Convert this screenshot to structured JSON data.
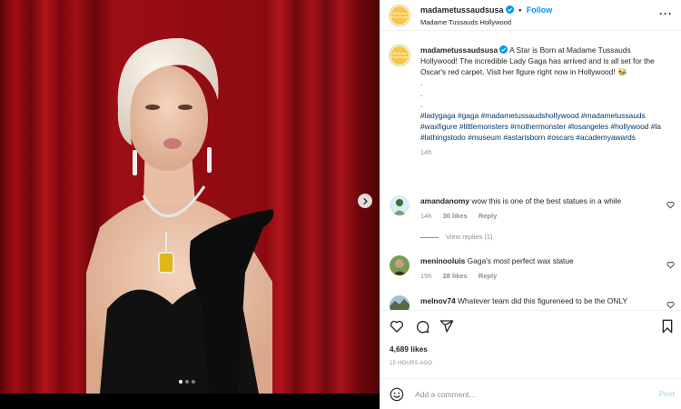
{
  "header": {
    "username": "madametussaudsusa",
    "separator": "•",
    "follow_label": "Follow",
    "location": "Madame Tussauds Hollywood",
    "more_label": "···",
    "avatar_text": "Madame Tussauds"
  },
  "caption": {
    "username": "madametussaudsusa",
    "text": "A Star is Born at Madame Tussauds Hollywood! The incredible Lady Gaga has arrived and is all set for the Oscar's red carpet. Visit her figure right now in Hollywood! 🐝",
    "dots": [
      ".",
      ".",
      "."
    ],
    "hashtags": "#ladygaga #gaga #madametussaudshollywood #madametussauds #waxfigure #littlemonsters #mothermonster #losangeles #hollywood #la #lathingstodo #museum #astarisborn #oscars #academyawards",
    "time": "14h"
  },
  "comments": [
    {
      "username": "amandanomy",
      "text": "wow this is one of the best statues in a while",
      "time": "14h",
      "likes": "30 likes",
      "reply_label": "Reply",
      "view_replies": "View replies (1)"
    },
    {
      "username": "meninooluis",
      "text": "Gaga's most perfect wax statue",
      "time": "15h",
      "likes": "28 likes",
      "reply_label": "Reply"
    },
    {
      "username": "melnov74",
      "text": "Whatever team did this figureneed to be the ONLY"
    }
  ],
  "actions": {
    "icons": [
      "heart-icon",
      "comment-icon",
      "share-icon",
      "bookmark-icon"
    ],
    "likes": "4,689 likes",
    "posted": "15 HOURS AGO"
  },
  "add_comment": {
    "placeholder": "Add a comment...",
    "post_label": "Post"
  },
  "carousel": {
    "slide_count": 3,
    "active_index": 0
  },
  "colors": {
    "link_blue": "#0095f6",
    "hashtag_blue": "#00376b",
    "muted": "#8e8e8e",
    "post_disabled": "#b2dffc"
  }
}
